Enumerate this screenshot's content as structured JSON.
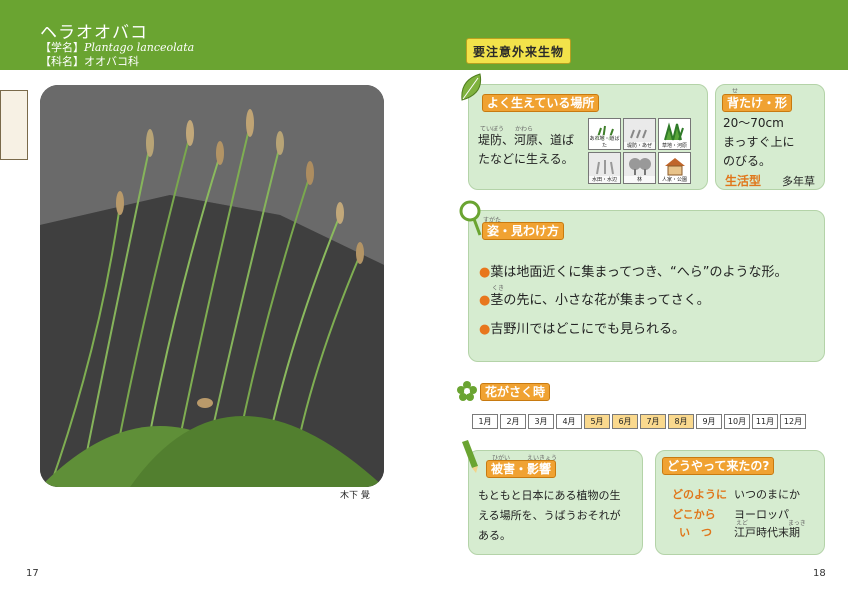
{
  "header": {
    "title": "ヘラオオバコ",
    "scientific_label": "【学名】",
    "scientific_name": "Plantago lanceolata",
    "family_label": "【科名】",
    "family_name": "オオバコ科",
    "badge": "要注意外来生物"
  },
  "photo": {
    "credit": "木下 覺"
  },
  "habitat": {
    "title": "よく生えている場所",
    "ruby_1": "ていぼう",
    "ruby_2": "かわら",
    "text_1": "堤防、河原、道ば",
    "text_2": "たなどに生える。",
    "cells": [
      {
        "label": "あれ地・道ばた",
        "active": true
      },
      {
        "label": "堤防・あぜ",
        "active": false
      },
      {
        "label": "草地・河原",
        "active": true
      },
      {
        "label": "水田・水辺",
        "active": false
      },
      {
        "label": "林",
        "active": false
      },
      {
        "label": "人家・公園",
        "active": true
      }
    ]
  },
  "height": {
    "title": "背たけ・形",
    "ruby": "せ",
    "line_1": "20〜70cm",
    "line_2": "まっすぐ上に",
    "line_3": "のびる。",
    "lifeform_label": "生活型",
    "lifeform_value": "多年草"
  },
  "features": {
    "title": "姿・見わけ方",
    "ruby": "すがた",
    "ruby_kuki": "くき",
    "bullets": [
      "葉は地面近くに集まってつき、“へら”のような形。",
      "茎の先に、小さな花が集まってさく。",
      "吉野川ではどこにでも見られる。"
    ]
  },
  "bloom": {
    "title": "花がさく時",
    "months": [
      {
        "label": "1月",
        "active": false
      },
      {
        "label": "2月",
        "active": false
      },
      {
        "label": "3月",
        "active": false
      },
      {
        "label": "4月",
        "active": false
      },
      {
        "label": "5月",
        "active": true
      },
      {
        "label": "6月",
        "active": true
      },
      {
        "label": "7月",
        "active": true
      },
      {
        "label": "8月",
        "active": true
      },
      {
        "label": "9月",
        "active": false
      },
      {
        "label": "10月",
        "active": false
      },
      {
        "label": "11月",
        "active": false
      },
      {
        "label": "12月",
        "active": false
      }
    ]
  },
  "damage": {
    "title": "被害・影響",
    "ruby_1": "ひがい",
    "ruby_2": "えいきょう",
    "line_1": "もともと日本にある植物の生",
    "line_2": "える場所を、うばうおそれが",
    "line_3": "ある。"
  },
  "origin": {
    "title": "どうやって来たの?",
    "how_label": "どのように",
    "how_value": "いつのまにか",
    "from_label": "どこから",
    "from_value": "ヨーロッパ",
    "when_label": "い　つ",
    "when_value": "江戸時代末期",
    "ruby_edo": "えど",
    "ruby_matsu": "まっき"
  },
  "pages": {
    "left": "17",
    "right": "18"
  },
  "colors": {
    "header_green": "#6aa431",
    "panel_green": "#d6ecd0",
    "accent_orange": "#f0a232",
    "badge_yellow": "#f2e24a"
  }
}
